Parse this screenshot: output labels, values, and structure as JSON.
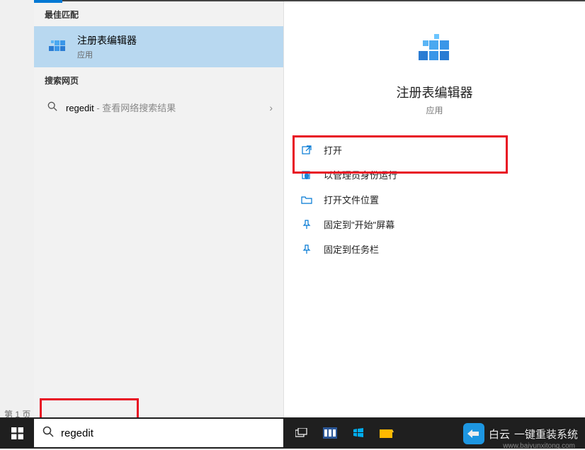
{
  "page_label": "第 1 页",
  "left": {
    "best_match_header": "最佳匹配",
    "best_match": {
      "title": "注册表编辑器",
      "sub": "应用"
    },
    "web_header": "搜索网页",
    "web_item": {
      "query": "regedit",
      "hint": " - 查看网络搜索结果"
    }
  },
  "detail": {
    "title": "注册表编辑器",
    "sub": "应用",
    "actions": {
      "open": "打开",
      "admin": "以管理员身份运行",
      "location": "打开文件位置",
      "pin_start": "固定到\"开始\"屏幕",
      "pin_taskbar": "固定到任务栏"
    }
  },
  "search_value": "regedit",
  "watermark": {
    "brand": "白云",
    "tagline": "一键重装系统",
    "url": "www.baiyunxitong.com"
  }
}
